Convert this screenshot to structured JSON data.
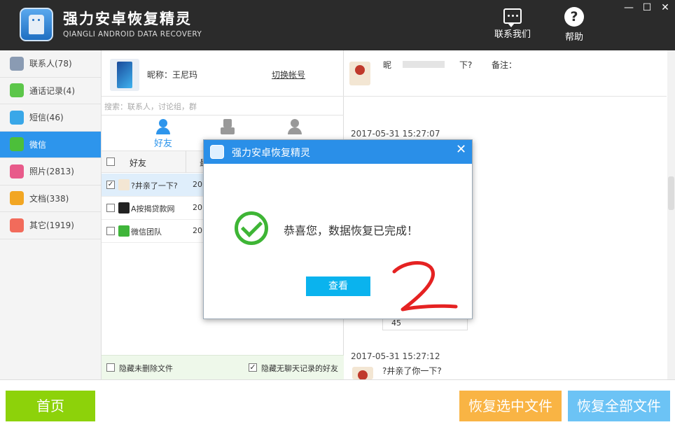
{
  "app": {
    "title": "强力安卓恢复精灵",
    "subtitle": "QIANGLI ANDROID DATA RECOVERY"
  },
  "header": {
    "contact_label": "联系我们",
    "help_label": "帮助",
    "help_glyph": "?",
    "min_glyph": "—",
    "max_glyph": "☐",
    "close_glyph": "✕"
  },
  "sidebar": {
    "items": [
      {
        "label": "联系人(78)",
        "icon": "contacts-icon",
        "color": "#8a9bb3"
      },
      {
        "label": "通话记录(4)",
        "icon": "call-log-icon",
        "color": "#5cc64a"
      },
      {
        "label": "短信(46)",
        "icon": "sms-icon",
        "color": "#39a7e8"
      },
      {
        "label": "微信",
        "icon": "wechat-icon",
        "color": "#4cbf3a",
        "active": true
      },
      {
        "label": "照片(2813)",
        "icon": "photo-icon",
        "color": "#e85a8a"
      },
      {
        "label": "文档(338)",
        "icon": "document-icon",
        "color": "#f2a623"
      },
      {
        "label": "其它(1919)",
        "icon": "other-icon",
        "color": "#f26b5b"
      }
    ]
  },
  "account": {
    "nickname": "昵称：王尼玛",
    "switch_label": "切换帐号"
  },
  "search": {
    "placeholder": "搜索：联系人，讨论组，群"
  },
  "tabs": [
    {
      "label": "好友",
      "active": true
    },
    {
      "label": "",
      "active": false
    },
    {
      "label": "",
      "active": false
    }
  ],
  "table": {
    "header_friend": "好友",
    "header_date": "最",
    "rows": [
      {
        "name": "?井亲了一下?",
        "date": "201",
        "checked": true,
        "selected": true
      },
      {
        "name": "A按揭贷款网",
        "date": "201",
        "checked": false,
        "selected": false
      },
      {
        "name": "微信团队",
        "date": "201",
        "checked": false,
        "selected": false
      }
    ]
  },
  "options": {
    "hide_undeleted": "隐藏未删除文件",
    "hide_no_chat": "隐藏无聊天记录的好友",
    "hide_undeleted_checked": false,
    "hide_no_chat_checked": true
  },
  "chat": {
    "top_prefix": "昵",
    "top_suffix": "下?",
    "note_label": "备注：",
    "timestamp1": "2017-05-31 15:27:07",
    "timestamp2": "2017-05-31 15:27:12",
    "message2": "?井亲了你一下?",
    "partial_text": "45"
  },
  "dialog": {
    "title": "强力安卓恢复精灵",
    "message": "恭喜您，数据恢复已完成！",
    "view_button": "查看",
    "close_glyph": "✕"
  },
  "bottom": {
    "home": "首页",
    "recover_selected": "恢复选中文件",
    "recover_all": "恢复全部文件",
    "home_color": "#8dd20a",
    "recover_selected_color": "#f9b444",
    "recover_all_color": "#6cc3f5"
  }
}
